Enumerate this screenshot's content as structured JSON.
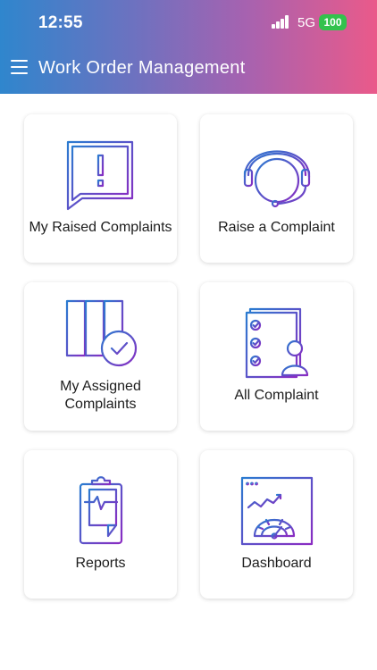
{
  "status_bar": {
    "time": "12:55",
    "network": "5G",
    "battery": "100"
  },
  "header": {
    "title": "Work Order Management",
    "menu_icon": "hamburger-menu-icon",
    "gradient": [
      "#2f86cd",
      "#6c72c0",
      "#a662b0",
      "#ea5a8a"
    ]
  },
  "colors": {
    "icon_gradient_start": "#2a7bd0",
    "icon_gradient_end": "#8a2bc2",
    "battery": "#33c24d"
  },
  "tiles": [
    {
      "label": "My Raised Complaints",
      "icon": "alert-speech-bubble-icon"
    },
    {
      "label": "Raise a Complaint",
      "icon": "headset-icon"
    },
    {
      "label": "My Assigned Complaints",
      "icon": "files-check-icon"
    },
    {
      "label": "All Complaint",
      "icon": "checklist-user-icon"
    },
    {
      "label": "Reports",
      "icon": "clipboard-report-icon"
    },
    {
      "label": "Dashboard",
      "icon": "dashboard-gauge-icon"
    }
  ]
}
